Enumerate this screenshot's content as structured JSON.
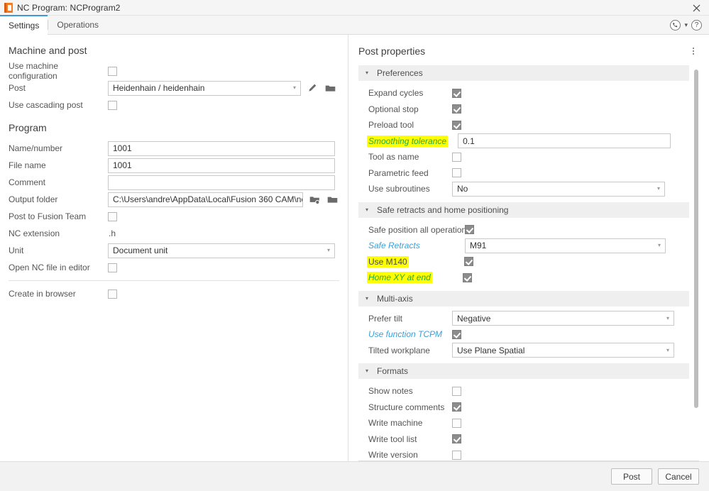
{
  "window": {
    "title": "NC Program: NCProgram2",
    "app_icon": "nc-program-icon",
    "close_icon": "close-icon"
  },
  "tabs": [
    {
      "label": "Settings",
      "active": true
    },
    {
      "label": "Operations",
      "active": false
    }
  ],
  "tabbar_icons": {
    "support": "phone-support-icon",
    "chevron": "chevron-down-icon",
    "help": "help-icon"
  },
  "left": {
    "machine_section_title": "Machine and post",
    "program_section_title": "Program",
    "rows": [
      {
        "label": "Use machine configuration",
        "type": "checkbox",
        "checked": false
      },
      {
        "label": "Post",
        "type": "combobox",
        "value": "Heidenhain / heidenhain",
        "icons": [
          "pencil-icon",
          "folder-icon"
        ]
      },
      {
        "label": "Use cascading post",
        "type": "checkbox",
        "checked": false
      }
    ],
    "program_rows": [
      {
        "label": "Name/number",
        "type": "textbox",
        "value": "1001"
      },
      {
        "label": "File name",
        "type": "textbox",
        "value": "1001"
      },
      {
        "label": "Comment",
        "type": "textbox",
        "value": ""
      },
      {
        "label": "Output folder",
        "type": "textbox",
        "value": "C:\\Users\\andre\\AppData\\Local\\Fusion 360 CAM\\nc",
        "icons": [
          "folder-settings-icon",
          "folder-icon"
        ]
      },
      {
        "label": "Post to Fusion Team",
        "type": "checkbox",
        "checked": false
      },
      {
        "label": "NC extension",
        "type": "plain",
        "value": ".h"
      },
      {
        "label": "Unit",
        "type": "combobox",
        "value": "Document unit"
      },
      {
        "label": "Open NC file in editor",
        "type": "checkbox",
        "checked": false
      },
      {
        "label": "Create in browser",
        "type": "checkbox",
        "checked": false
      }
    ]
  },
  "right": {
    "title": "Post properties",
    "kebab_icon": "more-options-icon",
    "sections": [
      {
        "name": "Preferences",
        "expanded": true,
        "rows": [
          {
            "label": "Expand cycles",
            "type": "checkbox",
            "checked": true,
            "style": "normal"
          },
          {
            "label": "Optional stop",
            "type": "checkbox",
            "checked": true,
            "style": "normal"
          },
          {
            "label": "Preload tool",
            "type": "checkbox",
            "checked": true,
            "style": "normal"
          },
          {
            "label": "Smoothing tolerance",
            "type": "textbox",
            "value": "0.1",
            "style": "highlight-green"
          },
          {
            "label": "Tool as name",
            "type": "checkbox",
            "checked": false,
            "style": "normal"
          },
          {
            "label": "Parametric feed",
            "type": "checkbox",
            "checked": false,
            "style": "normal"
          },
          {
            "label": "Use subroutines",
            "type": "combobox",
            "value": "No",
            "style": "normal"
          }
        ]
      },
      {
        "name": "Safe retracts and home positioning",
        "expanded": true,
        "rows": [
          {
            "label": "Safe position all operations",
            "type": "checkbox",
            "checked": true,
            "style": "wide"
          },
          {
            "label": "Safe Retracts",
            "type": "combobox",
            "value": "M91",
            "style": "link-wide"
          },
          {
            "label": "Use M140",
            "type": "checkbox",
            "checked": true,
            "style": "highlight-dark"
          },
          {
            "label": "Home XY at end",
            "type": "checkbox",
            "checked": true,
            "style": "highlight-green"
          }
        ]
      },
      {
        "name": "Multi-axis",
        "expanded": true,
        "rows": [
          {
            "label": "Prefer tilt",
            "type": "combobox",
            "value": "Negative",
            "style": "normal"
          },
          {
            "label": "Use function TCPM",
            "type": "checkbox",
            "checked": true,
            "style": "link"
          },
          {
            "label": "Tilted workplane",
            "type": "combobox",
            "value": "Use Plane Spatial",
            "style": "normal"
          }
        ]
      },
      {
        "name": "Formats",
        "expanded": true,
        "rows": [
          {
            "label": "Show notes",
            "type": "checkbox",
            "checked": false,
            "style": "normal"
          },
          {
            "label": "Structure comments",
            "type": "checkbox",
            "checked": true,
            "style": "normal"
          },
          {
            "label": "Write machine",
            "type": "checkbox",
            "checked": false,
            "style": "normal"
          },
          {
            "label": "Write tool list",
            "type": "checkbox",
            "checked": true,
            "style": "normal"
          },
          {
            "label": "Write version",
            "type": "checkbox",
            "checked": false,
            "style": "normal"
          }
        ]
      }
    ]
  },
  "footer": {
    "post_label": "Post",
    "cancel_label": "Cancel"
  },
  "colors": {
    "accent_tab": "#3e9ad6",
    "highlight": "#ffff00",
    "highlight_text": "#2aa83b",
    "link": "#3b9fd8",
    "section_header_bg": "#efefef",
    "checkbox_checked": "#8c8c8c"
  }
}
